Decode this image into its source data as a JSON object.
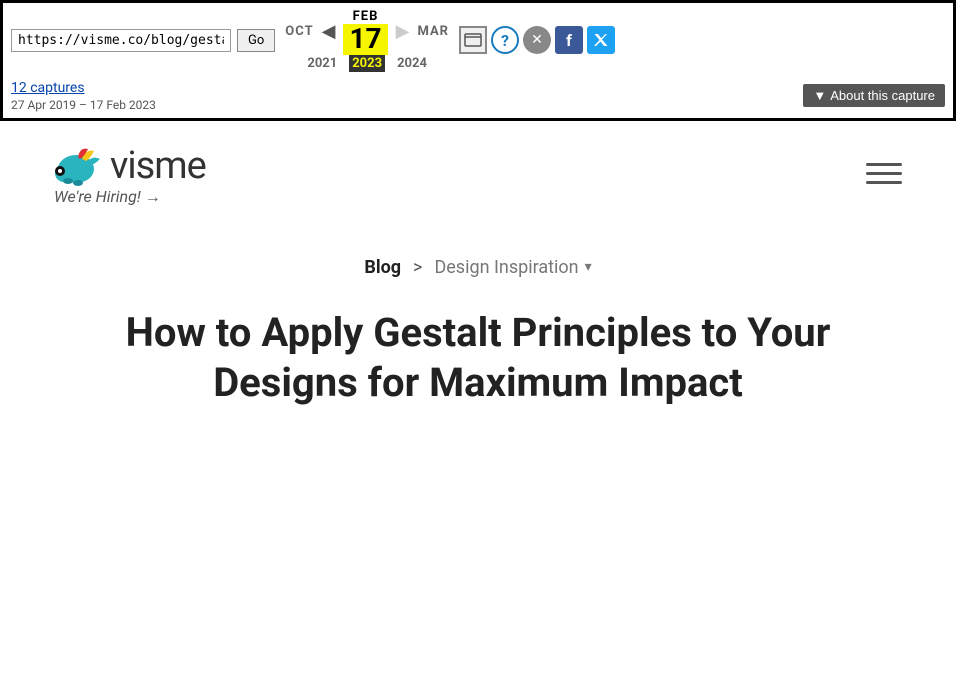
{
  "toolbar": {
    "url_value": "https://visme.co/blog/gestalt-d",
    "go_label": "Go",
    "months": [
      "OCT",
      "FEB",
      "MAR"
    ],
    "active_month": "FEB",
    "active_month_index": 1,
    "day": "17",
    "years": [
      "2021",
      "2023",
      "2024"
    ],
    "active_year": "2023",
    "captures_label": "12 captures",
    "captures_date_range": "27 Apr 2019 – 17 Feb 2023",
    "about_capture_label": "About this capture",
    "icons": {
      "window": "▣",
      "question": "?",
      "close": "✕",
      "facebook": "f",
      "twitter": "𝕏"
    }
  },
  "site": {
    "logo_text": "visme",
    "hiring_text": "We're Hiring! →"
  },
  "breadcrumb": {
    "blog": "Blog",
    "chevron": ">",
    "category": "Design Inspiration"
  },
  "article": {
    "title": "How to Apply Gestalt Principles to Your Designs for Maximum Impact"
  }
}
